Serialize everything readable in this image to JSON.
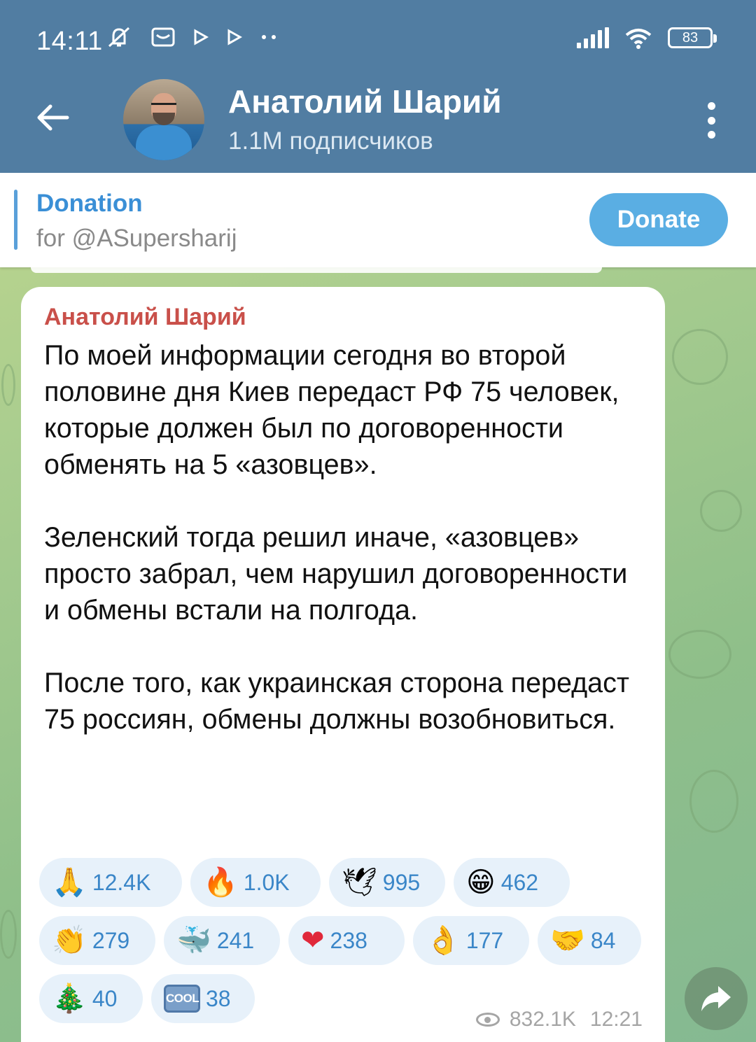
{
  "status_bar": {
    "time": "14:11",
    "icons_left": [
      "muted-notification-icon",
      "mail-icon",
      "play-icon",
      "play-icon",
      "more-dots-icon"
    ],
    "battery": "83"
  },
  "header": {
    "channel_name": "Анатолий Шарий",
    "subscribers": "1.1M подписчиков"
  },
  "donation": {
    "title": "Donation",
    "subtitle": "for @ASupersharij",
    "button_label": "Donate"
  },
  "message": {
    "author": "Анатолий Шарий",
    "paragraphs": [
      "По моей информации сегодня во второй половине дня Киев передаст РФ  75 человек, которые должен был по договоренности обменять на 5 «азовцев».",
      "Зеленский тогда решил иначе, «азовцев» просто забрал, чем нарушил договоренности и обмены встали на полгода.",
      "После того, как украинская сторона передаст 75 россиян, обмены должны возобновиться."
    ],
    "reactions": [
      {
        "emoji": "🙏",
        "icon": "folded-hands-icon",
        "count": "12.4K"
      },
      {
        "emoji": "🔥",
        "icon": "fire-icon",
        "count": "1.0K"
      },
      {
        "emoji": "🕊",
        "icon": "dove-icon",
        "count": "995"
      },
      {
        "emoji": "😁",
        "icon": "grinning-face-icon",
        "count": "462"
      },
      {
        "emoji": "👏",
        "icon": "clapping-hands-icon",
        "count": "279"
      },
      {
        "emoji": "🐳",
        "icon": "whale-icon",
        "count": "241"
      },
      {
        "emoji": "❤",
        "icon": "heart-icon",
        "count": "238"
      },
      {
        "emoji": "👌",
        "icon": "ok-hand-icon",
        "count": "177"
      },
      {
        "emoji": "🤝",
        "icon": "handshake-icon",
        "count": "84"
      },
      {
        "emoji": "🎄",
        "icon": "christmas-tree-icon",
        "count": "40"
      },
      {
        "emoji": "COOL",
        "icon": "cool-badge-icon",
        "count": "38"
      }
    ],
    "views": "832.1K",
    "time": "12:21"
  },
  "colors": {
    "header_bg": "#517da2",
    "author": "#c9504a",
    "link": "#3a8fd6",
    "donate_button": "#5aaee3",
    "reaction_bg": "#e7f1fa",
    "reaction_text": "#3a86c8"
  }
}
